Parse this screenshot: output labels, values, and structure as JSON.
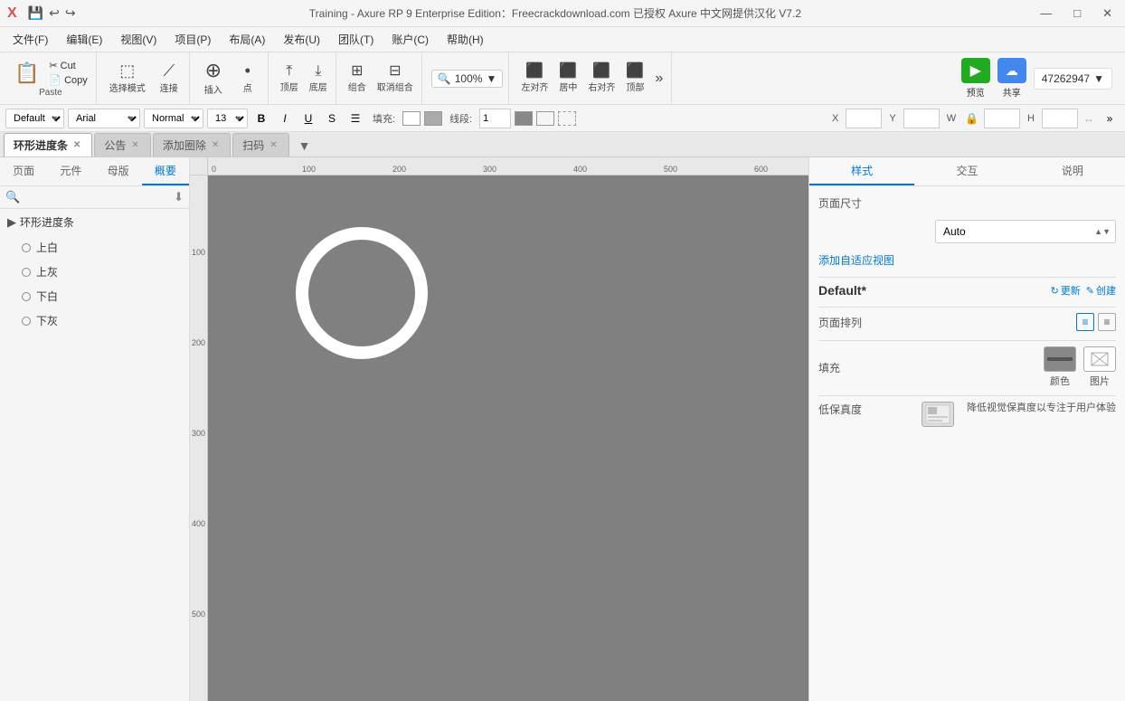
{
  "titlebar": {
    "logo": "X",
    "title": "Training - Axure RP 9 Enterprise Edition：Freecrackdownload.com 已授权   Axure 中文网提供汉化 V7.2",
    "controls": {
      "minimize": "—",
      "maximize": "□",
      "close": "✕"
    }
  },
  "menubar": {
    "items": [
      {
        "label": "文件(F)"
      },
      {
        "label": "编辑(E)"
      },
      {
        "label": "视图(V)"
      },
      {
        "label": "项目(P)"
      },
      {
        "label": "布局(A)"
      },
      {
        "label": "发布(U)"
      },
      {
        "label": "团队(T)"
      },
      {
        "label": "账户(C)"
      },
      {
        "label": "帮助(H)"
      }
    ]
  },
  "toolbar": {
    "clipboard": {
      "paste_label": "Paste",
      "copy_label": "Copy",
      "cut_label": "Cut",
      "paste_icon": "📋",
      "copy_icon": "📄",
      "cut_icon": "✂"
    },
    "select_label": "选择模式",
    "connect_label": "连接",
    "insert_label": "插入",
    "point_label": "点",
    "top_label": "顶层",
    "bottom_label": "底层",
    "group_label": "组合",
    "ungroup_label": "取消组合",
    "left_label": "左对齐",
    "center_label": "居中",
    "right_label": "右对齐",
    "top_align_label": "顶部",
    "more_label": "•••",
    "zoom_value": "100%",
    "left_align2_label": "左对齐",
    "center_align_label": "居中",
    "right_align2_label": "右对齐",
    "top_align2_label": "顶部",
    "preview_label": "预览",
    "share_label": "共享",
    "account_id": "47262947"
  },
  "format_toolbar": {
    "style_select": "Default",
    "font_select": "Arial",
    "weight_select": "Normal",
    "size_select": "13",
    "bold": "B",
    "italic": "I",
    "underline": "U",
    "strikethrough": "S",
    "list": "☰",
    "fill_label": "填充:",
    "stroke_label": "线段:",
    "stroke_value": "1",
    "x_label": "X",
    "y_label": "Y",
    "w_label": "W",
    "h_label": "H",
    "more_icon": "»"
  },
  "tabs": [
    {
      "label": "环形进度条",
      "active": true
    },
    {
      "label": "公告"
    },
    {
      "label": "添加圈除"
    },
    {
      "label": "扫码"
    }
  ],
  "left_sidebar": {
    "tabs": [
      {
        "label": "页面"
      },
      {
        "label": "元件"
      },
      {
        "label": "母版"
      },
      {
        "label": "概要",
        "active": true
      }
    ],
    "search_placeholder": "搜索",
    "pages": {
      "group_label": "环形进度条",
      "items": [
        {
          "label": "上白"
        },
        {
          "label": "上灰"
        },
        {
          "label": "下白"
        },
        {
          "label": "下灰"
        }
      ]
    }
  },
  "right_sidebar": {
    "tabs": [
      {
        "label": "样式",
        "active": true
      },
      {
        "label": "交互"
      },
      {
        "label": "说明"
      }
    ],
    "style_panel": {
      "page_size_label": "页面尺寸",
      "size_value": "Auto",
      "adaptive_link": "添加自适应视图",
      "default_label": "Default*",
      "update_label": "更新",
      "create_label": "创建",
      "page_layout_label": "页面排列",
      "fill_label": "填充",
      "fill_color_label": "颜色",
      "fill_image_label": "图片",
      "low_fidelity_label": "低保真度",
      "low_fidelity_desc": "降低视觉保真度以专注于用户体验"
    }
  },
  "canvas": {
    "zoom": "100%",
    "ruler_marks_h": [
      "0",
      "100",
      "200",
      "300",
      "400",
      "500",
      "600"
    ],
    "ruler_marks_v": [
      "100",
      "200",
      "300",
      "400",
      "500"
    ],
    "ring": {
      "size": 160,
      "stroke": 14,
      "color": "white"
    }
  }
}
